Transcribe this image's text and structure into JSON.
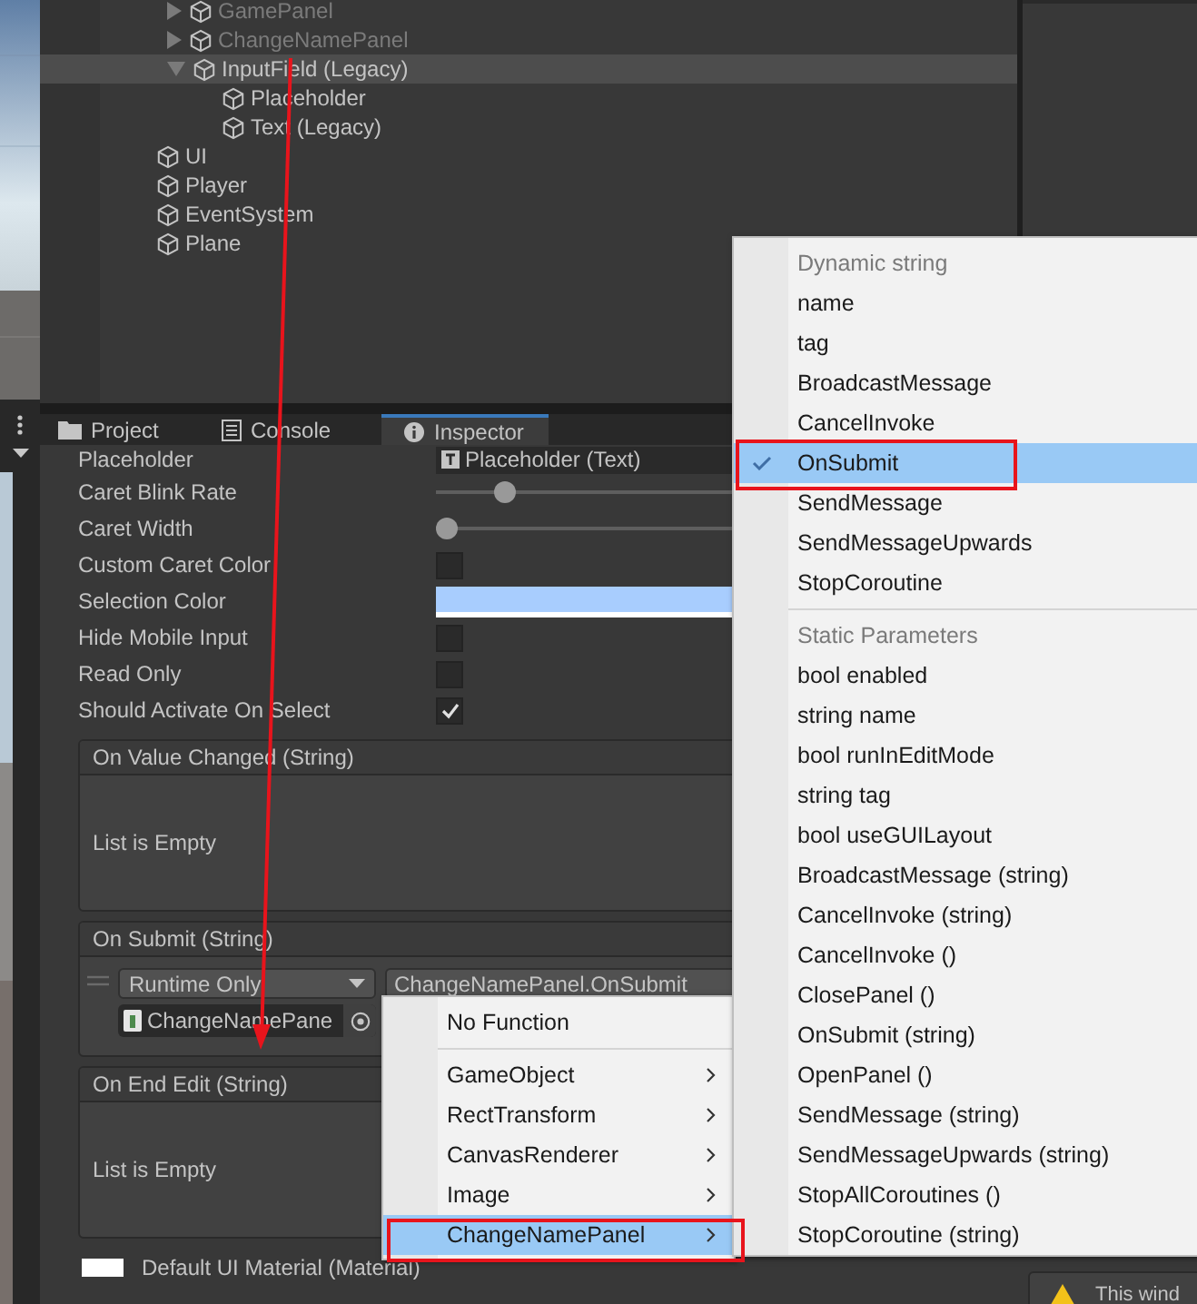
{
  "hierarchy": {
    "nested_items": [
      {
        "label": "GamePanel",
        "inactive": true,
        "expanded": false,
        "selected": false
      },
      {
        "label": "ChangeNamePanel",
        "inactive": true,
        "expanded": false,
        "selected": false
      },
      {
        "label": "InputField (Legacy)",
        "inactive": false,
        "expanded": true,
        "selected": true,
        "children": [
          {
            "label": "Placeholder",
            "inactive": false,
            "selected": false
          },
          {
            "label": "Text (Legacy)",
            "inactive": false,
            "selected": false
          }
        ]
      }
    ],
    "items": [
      {
        "label": "UI",
        "inactive": false,
        "selected": false
      },
      {
        "label": "Player",
        "inactive": false,
        "selected": false
      },
      {
        "label": "EventSystem",
        "inactive": false,
        "selected": false
      },
      {
        "label": "Plane",
        "inactive": false,
        "selected": false
      }
    ]
  },
  "tabs": [
    {
      "label": "Project",
      "selected": false
    },
    {
      "label": "Console",
      "selected": false
    },
    {
      "label": "Inspector",
      "selected": true
    }
  ],
  "inspector": {
    "properties": [
      {
        "label": "Placeholder",
        "kind": "object",
        "value": "Placeholder (Text)"
      },
      {
        "label": "Caret Blink Rate",
        "kind": "slider",
        "level": 0.2
      },
      {
        "label": "Caret Width",
        "kind": "slider",
        "level": 0
      },
      {
        "label": "Custom Caret Color",
        "kind": "checkbox",
        "checked": false
      },
      {
        "label": "Selection Color",
        "kind": "color",
        "color": "#a8cdfe"
      },
      {
        "label": "Hide Mobile Input",
        "kind": "checkbox",
        "checked": false
      },
      {
        "label": "Read Only",
        "kind": "checkbox",
        "checked": false
      },
      {
        "label": "Should Activate On Select",
        "kind": "checkbox",
        "checked": true
      }
    ],
    "events": [
      {
        "title": "On Value Changed (String)",
        "kind": "empty",
        "message": "List is Empty"
      },
      {
        "title": "On Submit (String)",
        "kind": "listeners",
        "listeners": [
          {
            "mode": "Runtime Only",
            "function": "ChangeNamePanel.OnSubmit",
            "target": "ChangeNamePane"
          }
        ]
      },
      {
        "title": "On End Edit (String)",
        "kind": "empty",
        "message": "List is Empty"
      }
    ],
    "material": "Default UI Material (Material)"
  },
  "warning": "This wind",
  "function_menu": {
    "items": [
      {
        "kind": "item",
        "label": "No Function",
        "submenu": false,
        "selected": false
      },
      {
        "kind": "separator"
      },
      {
        "kind": "item",
        "label": "GameObject",
        "submenu": true,
        "selected": false
      },
      {
        "kind": "item",
        "label": "RectTransform",
        "submenu": true,
        "selected": false
      },
      {
        "kind": "item",
        "label": "CanvasRenderer",
        "submenu": true,
        "selected": false
      },
      {
        "kind": "item",
        "label": "Image",
        "submenu": true,
        "selected": false
      },
      {
        "kind": "item",
        "label": "ChangeNamePanel",
        "submenu": true,
        "selected": true
      }
    ]
  },
  "sub_menu": {
    "sections": [
      {
        "header": "Dynamic string",
        "items": [
          {
            "label": "name",
            "selected": false
          },
          {
            "label": "tag",
            "selected": false
          },
          {
            "label": "BroadcastMessage",
            "selected": false
          },
          {
            "label": "CancelInvoke",
            "selected": false
          },
          {
            "label": "OnSubmit",
            "selected": true
          },
          {
            "label": "SendMessage",
            "selected": false
          },
          {
            "label": "SendMessageUpwards",
            "selected": false
          },
          {
            "label": "StopCoroutine",
            "selected": false
          }
        ]
      },
      {
        "header": "Static Parameters",
        "items": [
          {
            "label": "bool enabled",
            "selected": false
          },
          {
            "label": "string name",
            "selected": false
          },
          {
            "label": "bool runInEditMode",
            "selected": false
          },
          {
            "label": "string tag",
            "selected": false
          },
          {
            "label": "bool useGUILayout",
            "selected": false
          },
          {
            "label": "BroadcastMessage (string)",
            "selected": false
          },
          {
            "label": "CancelInvoke (string)",
            "selected": false
          },
          {
            "label": "CancelInvoke ()",
            "selected": false
          },
          {
            "label": "ClosePanel ()",
            "selected": false
          },
          {
            "label": "OnSubmit (string)",
            "selected": false
          },
          {
            "label": "OpenPanel ()",
            "selected": false
          },
          {
            "label": "SendMessage (string)",
            "selected": false
          },
          {
            "label": "SendMessageUpwards (string)",
            "selected": false
          },
          {
            "label": "StopAllCoroutines ()",
            "selected": false
          },
          {
            "label": "StopCoroutine (string)",
            "selected": false
          }
        ]
      }
    ]
  }
}
